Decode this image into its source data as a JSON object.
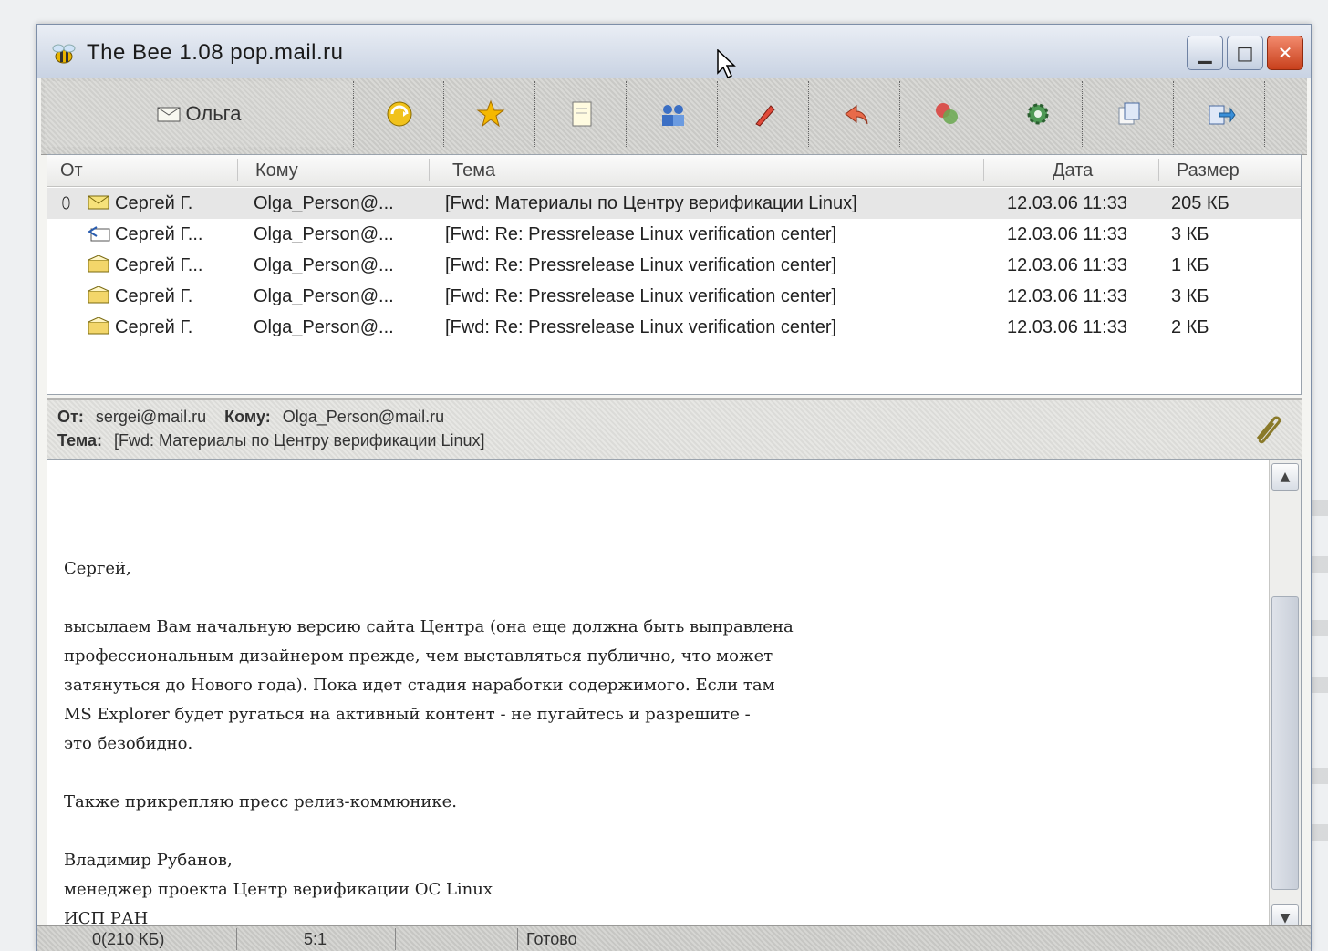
{
  "window": {
    "title": "The Bee 1.08   pop.mail.ru"
  },
  "toolbar": {
    "account_label": "Ольга",
    "buttons": [
      {
        "icon": "send-receive-icon"
      },
      {
        "icon": "star-icon"
      },
      {
        "icon": "new-message-icon"
      },
      {
        "icon": "address-book-icon"
      },
      {
        "icon": "edit-icon"
      },
      {
        "icon": "reply-icon"
      },
      {
        "icon": "filter-icon"
      },
      {
        "icon": "settings-gear-icon"
      },
      {
        "icon": "copy-icon"
      },
      {
        "icon": "forward-icon"
      }
    ]
  },
  "list": {
    "columns": {
      "from": "От",
      "to": "Кому",
      "subject": "Тема",
      "date": "Дата",
      "size": "Размер"
    },
    "rows": [
      {
        "from": "Сергей Г.",
        "to": "Olga_Person@...",
        "subject": "[Fwd: Материалы по Центру верификации Linux]",
        "date": "12.03.06 11:33",
        "size": "205 КБ",
        "icon": "envelope-attachment-icon"
      },
      {
        "from": "Сергей Г...",
        "to": "Olga_Person@...",
        "subject": "[Fwd: Re: Pressrelease Linux verification center]",
        "date": "12.03.06 11:33",
        "size": "3 КБ",
        "icon": "reply-envelope-icon"
      },
      {
        "from": "Сергей Г...",
        "to": "Olga_Person@...",
        "subject": "[Fwd: Re: Pressrelease Linux verification center]",
        "date": "12.03.06 11:33",
        "size": "1 КБ",
        "icon": "envelope-read-icon"
      },
      {
        "from": "Сергей Г.",
        "to": "Olga_Person@...",
        "subject": "[Fwd: Re: Pressrelease Linux verification center]",
        "date": "12.03.06 11:33",
        "size": "3 КБ",
        "icon": "envelope-read-icon"
      },
      {
        "from": "Сергей Г.",
        "to": "Olga_Person@...",
        "subject": "[Fwd: Re: Pressrelease Linux verification center]",
        "date": "12.03.06 11:33",
        "size": "2 КБ",
        "icon": "envelope-read-icon"
      }
    ]
  },
  "preview_header": {
    "from_label": "От:",
    "from_value": "sergei@mail.ru",
    "to_label": "Кому:",
    "to_value": "Olga_Person@mail.ru",
    "subject_label": "Тема:",
    "subject_value": "[Fwd: Материалы по Центру верификации Linux]"
  },
  "body": {
    "greeting": "Сергей,",
    "paragraph1": "высылаем Вам начальную версию сайта Центра (она еще должна быть выправлена\nпрофессиональным дизайнером прежде, чем выставляться публично, что может\nзатянуться до Нового года). Пока идет стадия наработки содержимого. Если там\nMS Explorer будет ругаться на активный контент - не пугайтесь и разрешите -\nэто безобидно.",
    "paragraph2": "Также прикрепляю пресс релиз-коммюнике.",
    "signature": "Владимир Рубанов,\nменеджер проекта Центр верификации ОС Linux\nИСП РАН"
  },
  "status": {
    "count": "0(210 КБ)",
    "position": "5:1",
    "state": "Готово"
  }
}
